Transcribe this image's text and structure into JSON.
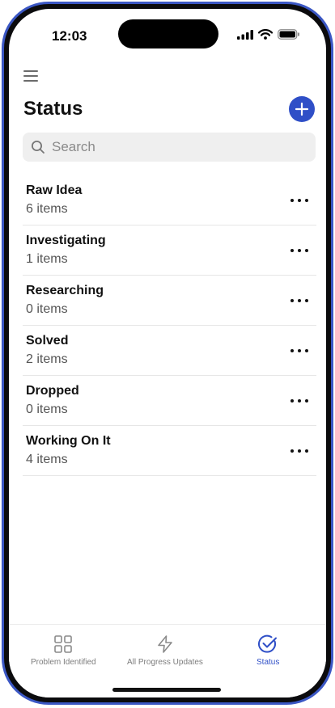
{
  "status_bar": {
    "time": "12:03"
  },
  "header": {
    "title": "Status"
  },
  "search": {
    "placeholder": "Search"
  },
  "statuses": [
    {
      "name": "Raw Idea",
      "count": "6 items"
    },
    {
      "name": "Investigating",
      "count": "1 items"
    },
    {
      "name": "Researching",
      "count": "0 items"
    },
    {
      "name": "Solved",
      "count": "2 items"
    },
    {
      "name": "Dropped",
      "count": "0 items"
    },
    {
      "name": "Working On It",
      "count": "4 items"
    }
  ],
  "tabs": [
    {
      "label": "Problem Identified",
      "icon": "grid-icon",
      "active": false
    },
    {
      "label": "All Progress Updates",
      "icon": "lightning-icon",
      "active": false
    },
    {
      "label": "Status",
      "icon": "check-circle-icon",
      "active": true
    }
  ],
  "colors": {
    "accent": "#2f4fc7",
    "frame": "#3b57c4"
  }
}
